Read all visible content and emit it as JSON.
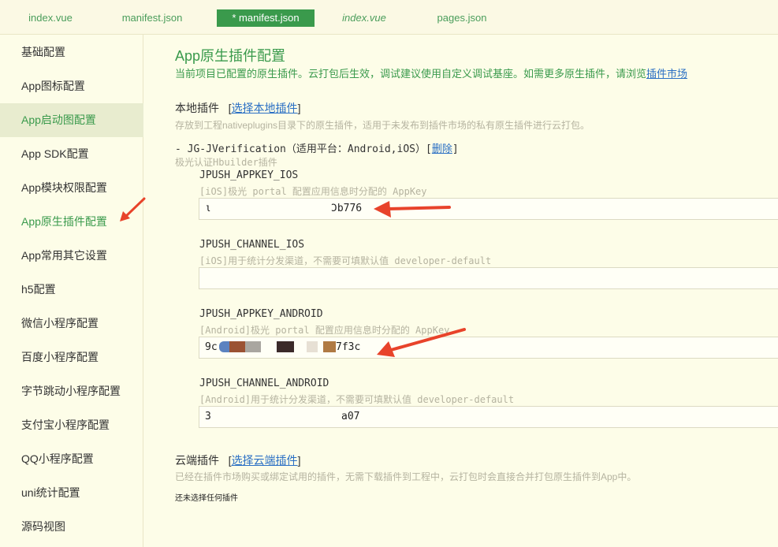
{
  "tabs": [
    {
      "label": "index.vue",
      "italic": false,
      "active": false
    },
    {
      "label": "manifest.json",
      "italic": false,
      "active": false
    },
    {
      "label": "* manifest.json",
      "italic": false,
      "active": true
    },
    {
      "label": "index.vue",
      "italic": true,
      "active": false
    },
    {
      "label": "pages.json",
      "italic": false,
      "active": false
    }
  ],
  "sidebar": {
    "items": [
      {
        "label": "基础配置"
      },
      {
        "label": "App图标配置"
      },
      {
        "label": "App启动图配置",
        "selected": true
      },
      {
        "label": "App  SDK配置"
      },
      {
        "label": "App模块权限配置"
      },
      {
        "label": "App原生插件配置",
        "current": true
      },
      {
        "label": "App常用其它设置"
      },
      {
        "label": "h5配置"
      },
      {
        "label": "微信小程序配置"
      },
      {
        "label": "百度小程序配置"
      },
      {
        "label": "字节跳动小程序配置"
      },
      {
        "label": "支付宝小程序配置"
      },
      {
        "label": "QQ小程序配置"
      },
      {
        "label": "uni统计配置"
      },
      {
        "label": "源码视图"
      }
    ]
  },
  "main": {
    "title": "App原生插件配置",
    "desc_prefix": "当前项目已配置的原生插件。云打包后生效，调试建议使用自定义调试基座。如需更多原生插件，请浏览",
    "desc_link": "插件市场",
    "local": {
      "title": "本地插件",
      "link": "选择本地插件",
      "desc": "存放到工程nativeplugins目录下的原生插件，适用于未发布到插件市场的私有原生插件进行云打包。"
    },
    "plugin": {
      "prefix": "- JG-JVerification（适用平台：Android,iOS）[",
      "delete": "删除",
      "suffix": "]",
      "desc": "极光认证Hbuilder插件"
    },
    "fields": [
      {
        "label": "JPUSH_APPKEY_IOS",
        "hint": "[iOS]极光 portal 配置应用信息时分配的 AppKey",
        "value_start": "ι",
        "value_end": "Ͻb776"
      },
      {
        "label": "JPUSH_CHANNEL_IOS",
        "hint": "[iOS]用于统计分发渠道，不需要可填默认值 developer-default",
        "value_start": "",
        "value_end": ""
      },
      {
        "label": "JPUSH_APPKEY_ANDROID",
        "hint": "[Android]极光 portal 配置应用信息时分配的 AppKey",
        "value_start": "9c",
        "value_end": "7f3c"
      },
      {
        "label": "JPUSH_CHANNEL_ANDROID",
        "hint": "[Android]用于统计分发渠道，不需要可填默认值 developer-default",
        "value_start": "3",
        "value_end": "a07"
      }
    ],
    "cloud": {
      "title": "云端插件",
      "link": "选择云端插件",
      "desc": "已经在插件市场购买或绑定试用的插件，无需下载插件到工程中，云打包时会直接合并打包原生插件到App中。",
      "empty": "还未选择任何插件"
    }
  },
  "colors": {
    "accent": "#3a9a4c",
    "link": "#2a6fc4",
    "annotation_arrow": "#e8432a"
  }
}
